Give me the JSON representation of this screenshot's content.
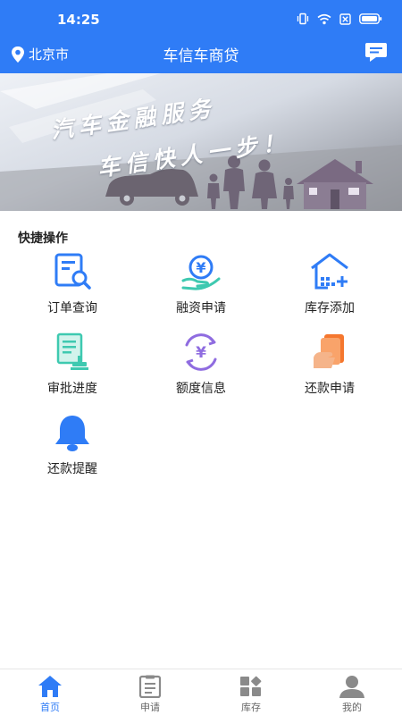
{
  "status_bar": {
    "time": "14:25"
  },
  "navbar": {
    "city": "北京市",
    "title": "车信车商贷"
  },
  "banner": {
    "line1": "汽车金融服务",
    "line2": "车信快人一步！"
  },
  "quick_actions": {
    "title": "快捷操作",
    "items": [
      {
        "label": "订单查询",
        "icon": "order-search-icon"
      },
      {
        "label": "融资申请",
        "icon": "finance-apply-icon"
      },
      {
        "label": "库存添加",
        "icon": "inventory-add-icon"
      },
      {
        "label": "审批进度",
        "icon": "approval-progress-icon"
      },
      {
        "label": "额度信息",
        "icon": "credit-limit-icon"
      },
      {
        "label": "还款申请",
        "icon": "repayment-apply-icon"
      },
      {
        "label": "还款提醒",
        "icon": "repayment-reminder-icon"
      }
    ]
  },
  "tabbar": {
    "items": [
      {
        "label": "首页",
        "icon": "home-icon",
        "active": true
      },
      {
        "label": "申请",
        "icon": "clipboard-icon"
      },
      {
        "label": "库存",
        "icon": "inventory-icon"
      },
      {
        "label": "我的",
        "icon": "profile-icon"
      }
    ]
  },
  "colors": {
    "primary": "#2f7cf6",
    "teal": "#3ec9b0",
    "purple": "#8f6ce0",
    "orange": "#f5772e"
  }
}
